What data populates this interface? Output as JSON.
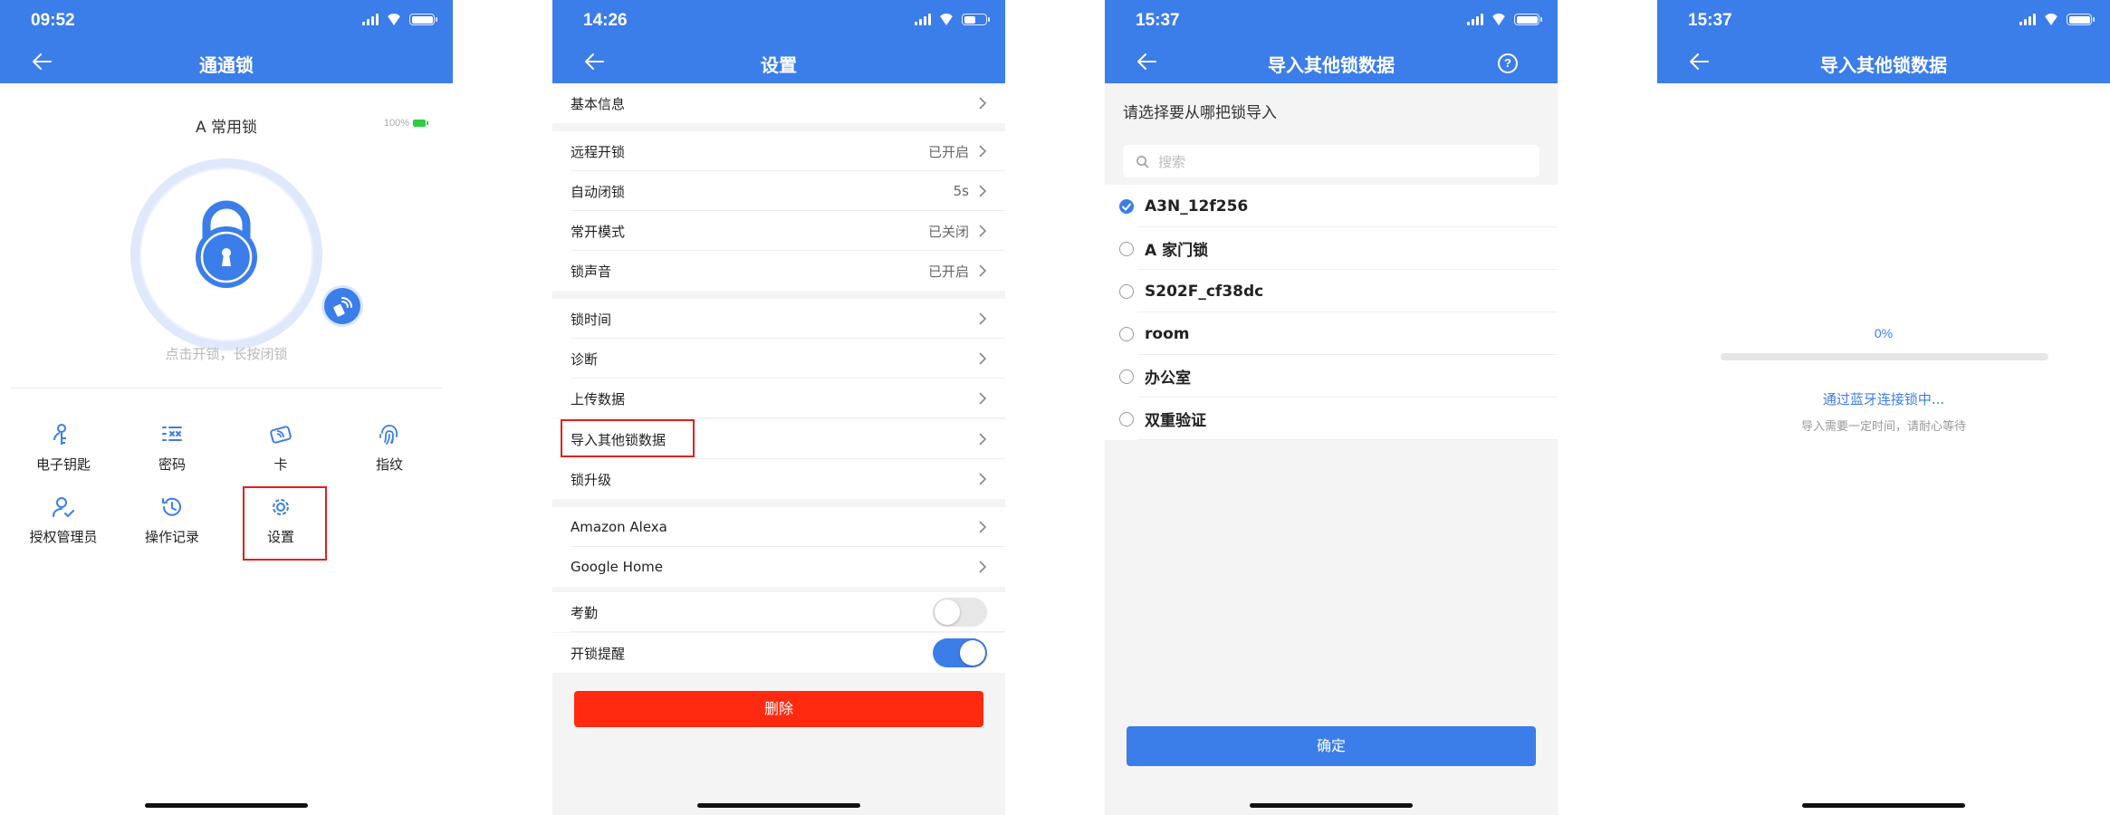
{
  "colors": {
    "primary": "#3b7de9",
    "danger": "#ff2a0f",
    "highlight": "#e02020",
    "battery_green": "#2ecc40"
  },
  "screen1": {
    "time": "09:52",
    "title": "通通锁",
    "lock_name": "A 常用锁",
    "battery_pct": "100%",
    "hint": "点击开锁，长按闭锁",
    "menu": [
      {
        "label": "电子钥匙",
        "icon": "key-person-icon"
      },
      {
        "label": "密码",
        "icon": "password-icon"
      },
      {
        "label": "卡",
        "icon": "card-icon"
      },
      {
        "label": "指纹",
        "icon": "fingerprint-icon"
      },
      {
        "label": "授权管理员",
        "icon": "admin-icon"
      },
      {
        "label": "操作记录",
        "icon": "history-icon"
      },
      {
        "label": "设置",
        "icon": "gear-icon"
      }
    ]
  },
  "screen2": {
    "time": "14:26",
    "title": "设置",
    "rows": [
      {
        "label": "基本信息",
        "value": ""
      },
      {
        "label": "远程开锁",
        "value": "已开启"
      },
      {
        "label": "自动闭锁",
        "value": "5s"
      },
      {
        "label": "常开模式",
        "value": "已关闭"
      },
      {
        "label": "锁声音",
        "value": "已开启"
      },
      {
        "label": "锁时间",
        "value": ""
      },
      {
        "label": "诊断",
        "value": ""
      },
      {
        "label": "上传数据",
        "value": ""
      },
      {
        "label": "导入其他锁数据",
        "value": ""
      },
      {
        "label": "锁升级",
        "value": ""
      },
      {
        "label": "Amazon Alexa",
        "value": ""
      },
      {
        "label": "Google Home",
        "value": ""
      }
    ],
    "toggles": [
      {
        "label": "考勤",
        "on": false
      },
      {
        "label": "开锁提醒",
        "on": true
      }
    ],
    "delete_label": "删除"
  },
  "screen3": {
    "time": "15:37",
    "title": "导入其他锁数据",
    "help_icon": "?",
    "prompt": "请选择要从哪把锁导入",
    "search_placeholder": "搜索",
    "options": [
      {
        "label": "A3N_12f256",
        "selected": true
      },
      {
        "label": "A 家门锁",
        "selected": false
      },
      {
        "label": "S202F_cf38dc",
        "selected": false
      },
      {
        "label": "room",
        "selected": false
      },
      {
        "label": "办公室",
        "selected": false
      },
      {
        "label": "双重验证",
        "selected": false
      }
    ],
    "confirm_label": "确定"
  },
  "screen4": {
    "time": "15:37",
    "title": "导入其他锁数据",
    "progress_text": "0%",
    "progress": 0,
    "connecting": "通过蓝牙连接锁中...",
    "wait_hint": "导入需要一定时间，请耐心等待"
  }
}
